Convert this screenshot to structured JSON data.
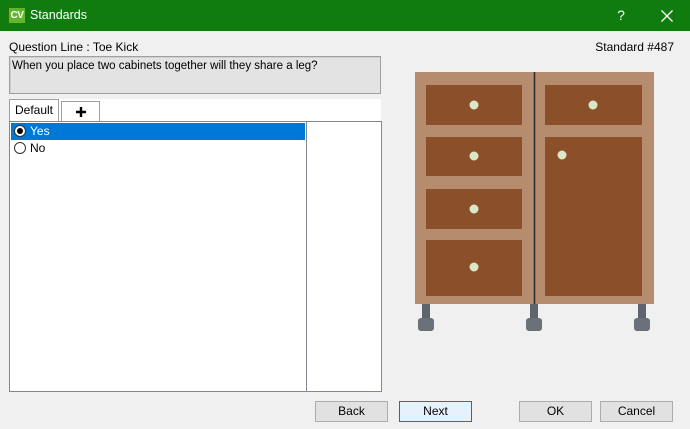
{
  "window": {
    "app_icon_text": "CV",
    "title": "Standards",
    "help_label": "?"
  },
  "header": {
    "question_line": "Question Line : Toe Kick",
    "standard_number": "Standard #487"
  },
  "question": {
    "text": "When you place two cabinets together will they share a leg?"
  },
  "tabs": [
    {
      "label": "Default",
      "active": true
    },
    {
      "label": "+",
      "icon": "plus-icon"
    }
  ],
  "options": [
    {
      "label": "Yes",
      "selected": true
    },
    {
      "label": "No",
      "selected": false
    }
  ],
  "buttons": {
    "back": "Back",
    "next": "Next",
    "ok": "OK",
    "cancel": "Cancel"
  },
  "colors": {
    "titlebar": "#107c10",
    "selection": "#0078d7",
    "cabinet_frame": "#b58d6e",
    "drawer_front": "#8b4f29",
    "knob": "#d9e6c8",
    "leg": "#6b7178"
  }
}
